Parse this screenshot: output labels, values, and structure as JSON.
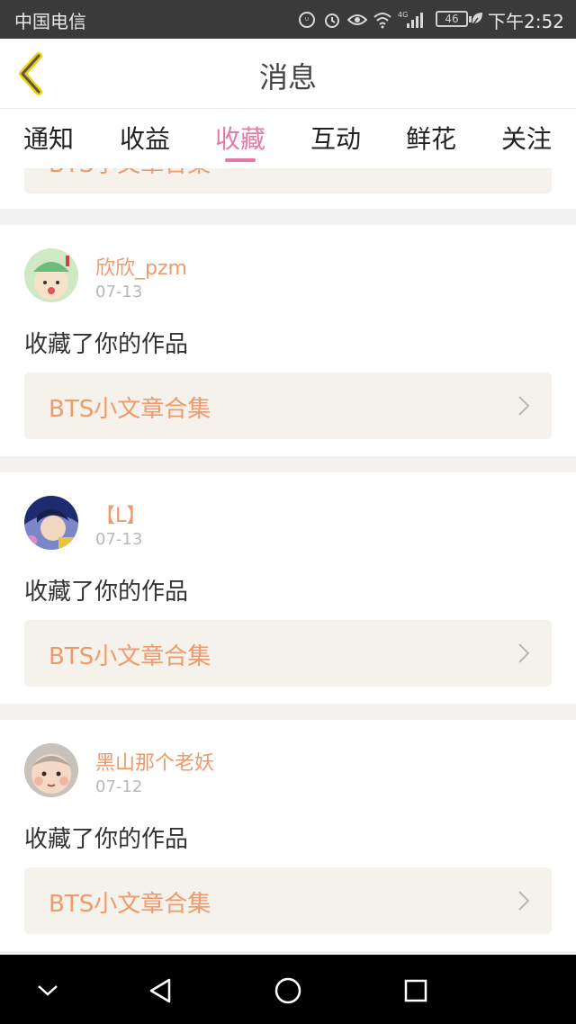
{
  "status_bar": {
    "carrier": "中国电信",
    "network": "4G",
    "battery": "46",
    "time": "下午2:52"
  },
  "header": {
    "title": "消息",
    "back_icon": "chevron-left-icon"
  },
  "tabs": [
    {
      "label": "通知",
      "active": false
    },
    {
      "label": "收益",
      "active": false
    },
    {
      "label": "收藏",
      "active": true
    },
    {
      "label": "互动",
      "active": false
    },
    {
      "label": "鲜花",
      "active": false
    },
    {
      "label": "关注",
      "active": false
    }
  ],
  "feed": {
    "partial_item_title": "BTS小文章合集",
    "items": [
      {
        "username": "欣欣_pzm",
        "date": "07-13",
        "action": "收藏了你的作品",
        "work_title": "BTS小文章合集"
      },
      {
        "username": "【L】",
        "date": "07-13",
        "action": "收藏了你的作品",
        "work_title": "BTS小文章合集"
      },
      {
        "username": "黑山那个老妖",
        "date": "07-12",
        "action": "收藏了你的作品",
        "work_title": "BTS小文章合集"
      }
    ]
  },
  "colors": {
    "accent_pink": "#e57aa6",
    "username_orange": "#ef9a6b",
    "link_box_bg": "#f4f2ea",
    "status_bar_bg": "#3a3a3a"
  }
}
